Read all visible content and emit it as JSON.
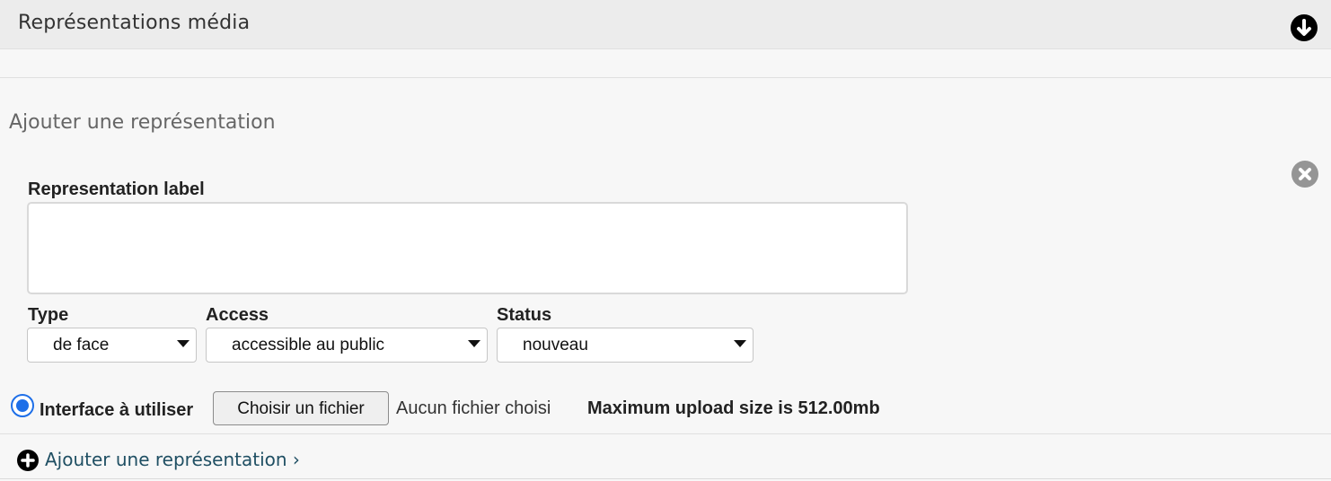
{
  "header": {
    "title": "Représentations média",
    "toggle_icon": "arrow-down-circle-icon"
  },
  "form": {
    "section_title": "Ajouter une représentation",
    "remove_icon": "close-circle-icon",
    "representation_label": {
      "label": "Representation label",
      "value": ""
    },
    "type": {
      "label": "Type",
      "selected": "de face"
    },
    "access": {
      "label": "Access",
      "selected": "accessible au public"
    },
    "status": {
      "label": "Status",
      "selected": "nouveau"
    },
    "interface": {
      "label": "Interface à utiliser",
      "selected": true,
      "button_label": "Choisir un fichier",
      "file_status": "Aucun fichier choisi",
      "upload_limit": "Maximum upload size is 512.00mb"
    }
  },
  "footer": {
    "add_link": "Ajouter une représentation ›",
    "add_icon": "plus-circle-icon"
  }
}
